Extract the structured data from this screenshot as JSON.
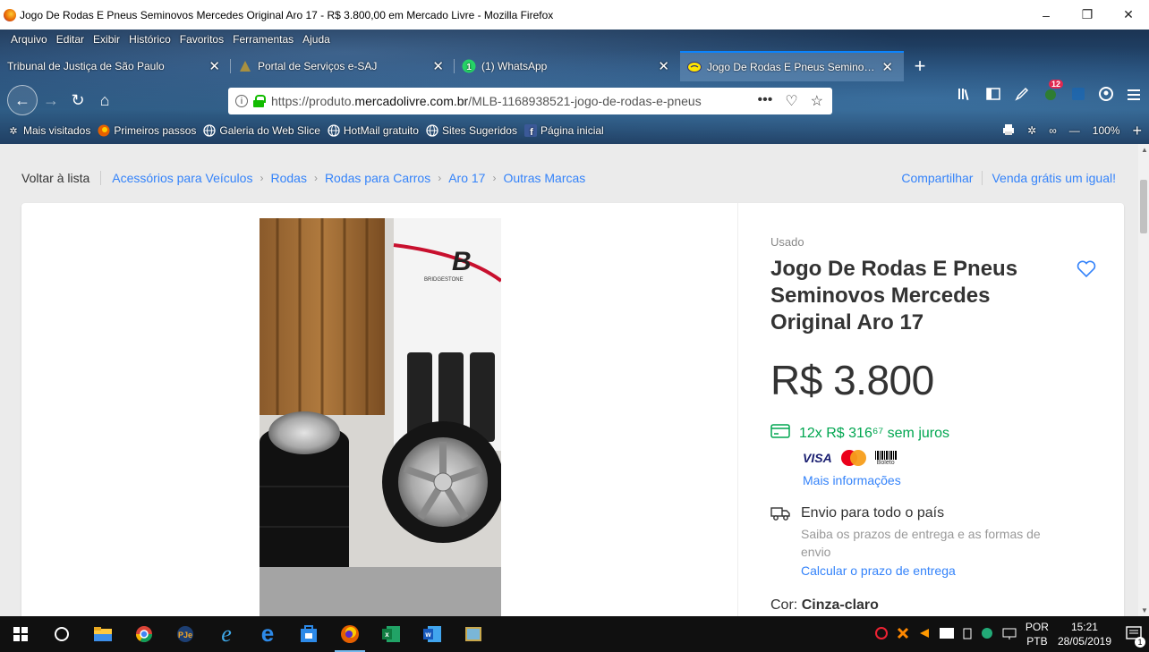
{
  "window": {
    "title": "Jogo De Rodas E Pneus Seminovos Mercedes Original Aro 17 - R$ 3.800,00 em Mercado Livre - Mozilla Firefox",
    "minimize": "–",
    "maximize": "❐",
    "close": "✕"
  },
  "menu": [
    "Arquivo",
    "Editar",
    "Exibir",
    "Histórico",
    "Favoritos",
    "Ferramentas",
    "Ajuda"
  ],
  "tabs": [
    {
      "label": "Tribunal de Justiça de São Paulo",
      "icon": "none",
      "active": false
    },
    {
      "label": "Portal de Serviços e-SAJ",
      "icon": "esaj-icon",
      "active": false
    },
    {
      "label": "(1) WhatsApp",
      "icon": "whatsapp-icon",
      "active": false
    },
    {
      "label": "Jogo De Rodas E Pneus Seminovos Mercedes",
      "icon": "mercadolivre-icon",
      "active": true
    }
  ],
  "tab_close": "✕",
  "new_tab": "+",
  "nav": {
    "back": "←",
    "forward": "→",
    "reload": "↻",
    "home": "⌂"
  },
  "url": {
    "prefix": "https://produto.",
    "domain": "mercadolivre.com.br",
    "path": "/MLB-1168938521-jogo-de-rodas-e-pneus",
    "more": "•••",
    "pocket": "♡",
    "star": "☆",
    "info": "i"
  },
  "bookmarks": [
    {
      "label": "Mais visitados",
      "icon": "gear-icon"
    },
    {
      "label": "Primeiros passos",
      "icon": "firefox-icon"
    },
    {
      "label": "Galeria do Web Slice",
      "icon": "globe-icon"
    },
    {
      "label": "HotMail gratuito",
      "icon": "globe-icon"
    },
    {
      "label": "Sites Sugeridos",
      "icon": "globe-icon"
    },
    {
      "label": "Página inicial",
      "icon": "facebook-icon"
    }
  ],
  "bookmark_right": {
    "zoom": "100%",
    "zoom_in": "+",
    "zoom_out": "—"
  },
  "toolbar_badge": "12",
  "breadcrumb": {
    "back": "Voltar à lista",
    "items": [
      "Acessórios para Veículos",
      "Rodas",
      "Rodas para Carros",
      "Aro 17",
      "Outras Marcas"
    ],
    "separator": "›"
  },
  "share": {
    "share": "Compartilhar",
    "sell": "Venda grátis um igual!"
  },
  "product": {
    "condition": "Usado",
    "title": "Jogo De Rodas E Pneus Seminovos Mercedes Original Aro 17",
    "price": "R$ 3.800",
    "installments": "12x R$ 316⁶⁷ sem juros",
    "payment_visa": "VISA",
    "payment_boleto": "Boleto",
    "more_info": "Mais informações",
    "shipping_title": "Envio para todo o país",
    "shipping_sub": "Saiba os prazos de entrega e as formas de envio",
    "shipping_calc": "Calcular o prazo de entrega",
    "color_label": "Cor:",
    "color_value": "Cinza-claro",
    "photo_brand": "BRIDGESTONE"
  },
  "colors": {
    "link": "#3483fa",
    "green": "#00a650",
    "text": "#333333",
    "page_bg": "#ebebeb"
  },
  "taskbar": {
    "lang_top": "POR",
    "lang_bottom": "PTB",
    "time": "15:21",
    "date": "28/05/2019",
    "notifications": "1"
  }
}
